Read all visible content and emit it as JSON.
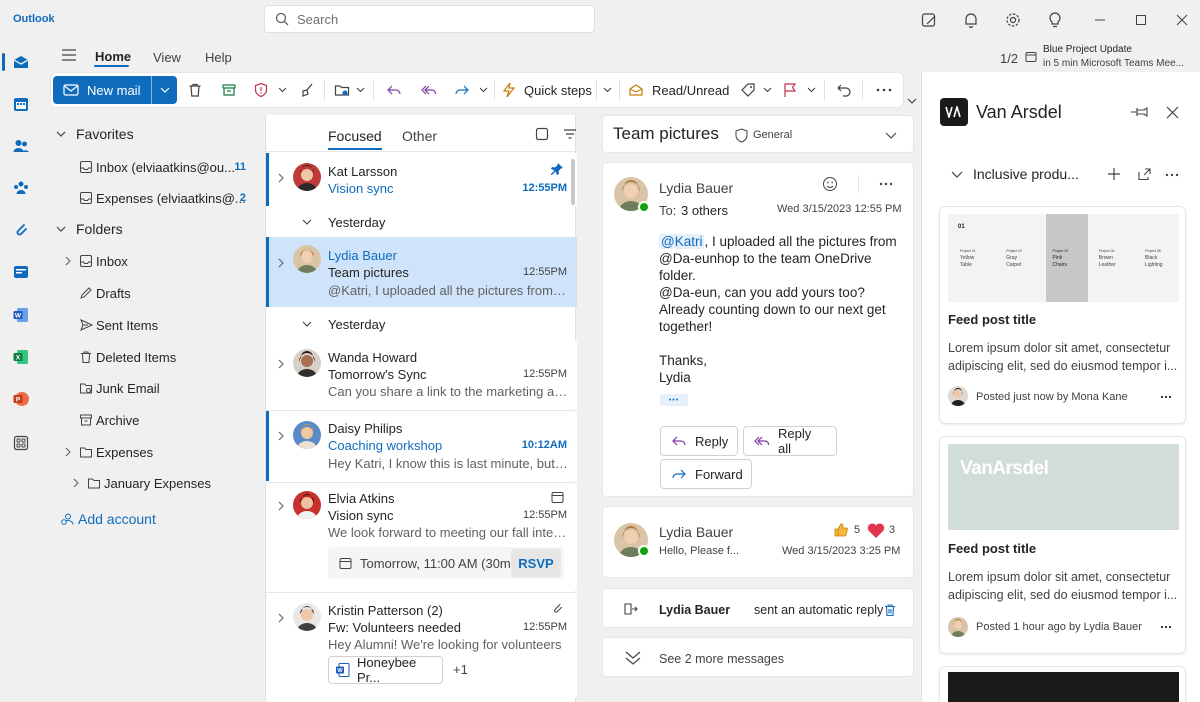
{
  "app": {
    "title": "Outlook"
  },
  "search": {
    "placeholder": "Search"
  },
  "ribbon_tabs": [
    "Home",
    "View",
    "Help"
  ],
  "notification": {
    "count": "1/2",
    "title": "Blue Project Update",
    "subtitle": "in 5 min Microsoft Teams Mee..."
  },
  "ribbon": {
    "new_mail": "New mail",
    "quick_steps": "Quick steps",
    "read_unread": "Read/Unread"
  },
  "folders": {
    "favorites_label": "Favorites",
    "favorites": [
      {
        "label": "Inbox (elviaatkins@ou...",
        "count": "11"
      },
      {
        "label": "Expenses (elviaatkins@...",
        "count": "2"
      }
    ],
    "folders_label": "Folders",
    "items": [
      "Inbox",
      "Drafts",
      "Sent Items",
      "Deleted Items",
      "Junk Email",
      "Archive",
      "Expenses",
      "January Expenses"
    ],
    "add_account": "Add account"
  },
  "list": {
    "tabs": {
      "focused": "Focused",
      "other": "Other"
    },
    "group_yesterday": "Yesterday",
    "messages": [
      {
        "sender": "Kat Larsson",
        "subject": "Vision sync",
        "time": "12:55PM"
      },
      {
        "sender": "Lydia Bauer",
        "subject": "Team pictures",
        "time": "12:55PM",
        "preview": "@Katri, I uploaded all the pictures from o..."
      },
      {
        "sender": "Wanda Howard",
        "subject": "Tomorrow's Sync",
        "time": "12:55PM",
        "preview": "Can you share a link to the marketing asse..."
      },
      {
        "sender": "Daisy Philips",
        "subject": "Coaching workshop",
        "time": "10:12AM",
        "preview": "Hey Katri, I know this is last minute, but d..."
      },
      {
        "sender": "Elvia Atkins",
        "subject": "Vision sync",
        "time": "12:55PM",
        "preview": "We look forward to meeting our fall intern...",
        "event": "Tomorrow, 11:00 AM (30m)",
        "rsvp": "RSVP"
      },
      {
        "sender": "Kristin Patterson (2)",
        "subject": "Fw: Volunteers needed",
        "time": "12:55PM",
        "preview": "Hey Alumni! We're looking for volunteers",
        "attachment": "Honeybee Pr...",
        "more": "+1"
      }
    ]
  },
  "conversation": {
    "title": "Team pictures",
    "sensitivity": "General",
    "message1": {
      "sender": "Lydia Bauer",
      "to_label": "To:",
      "to": "3 others",
      "date": "Wed 3/15/2023 12:55 PM",
      "mention": "@Katri",
      "body_1": ", I uploaded all the pictures from",
      "body_2": "@Da-eunhop to the team OneDrive",
      "body_3": "folder.",
      "body_4": "@Da-eun, can you add yours too?",
      "body_5": "Already counting down to our next get",
      "body_6": "together!",
      "thanks": "Thanks,",
      "signature": "Lydia",
      "ellipsis": "•••",
      "reply": "Reply",
      "reply_all": "Reply all",
      "forward": "Forward"
    },
    "message2": {
      "sender": "Lydia Bauer",
      "preview": "Hello, Please f...",
      "date": "Wed 3/15/2023 3:25 PM",
      "likes": "5",
      "hearts": "3"
    },
    "auto_reply": {
      "sender": "Lydia Bauer",
      "text": "sent an automatic reply"
    },
    "see_more": "See 2 more messages"
  },
  "side_panel": {
    "title": "Van Arsdel",
    "section": "Inclusive produ...",
    "cards": [
      {
        "title": "Feed post title",
        "body_1": "Lorem ipsum dolor sit amet, consectetur",
        "body_2": "adipiscing elit, sed do eiusmod tempor i...",
        "meta": "Posted just now by Mona Kane"
      },
      {
        "title": "Feed post title",
        "body_1": "Lorem ipsum dolor sit amet, consectetur",
        "body_2": "adipiscing elit, sed do eiusmod tempor i...",
        "meta": "Posted 1 hour ago by Lydia Bauer",
        "logo": "VanArsdel"
      }
    ],
    "doc_preview": {
      "heading": "01",
      "cols": [
        {
          "small": "Project 01",
          "a": "Yellow",
          "b": "Table"
        },
        {
          "small": "Project 02",
          "a": "Gray",
          "b": "Carpet"
        },
        {
          "small": "Project 03",
          "a": "Pink",
          "b": "Chairs"
        },
        {
          "small": "Project 04",
          "a": "Brown",
          "b": "Leather"
        },
        {
          "small": "Project 05",
          "a": "Black",
          "b": "Lighting"
        }
      ]
    }
  },
  "colors": {
    "accent": "#0f6cbd",
    "selected_bg": "#cfe4fa",
    "reply_purple": "#7e3ca3"
  }
}
